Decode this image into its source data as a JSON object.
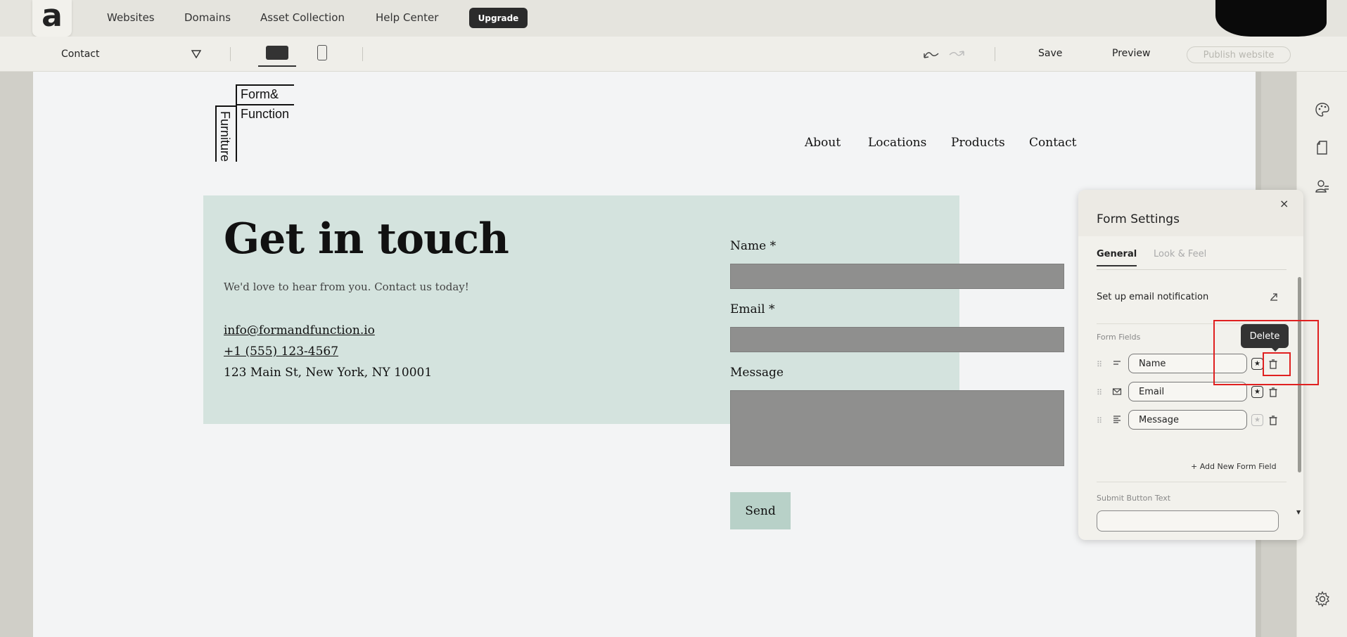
{
  "topnav": {
    "logo_letter": "a",
    "links": [
      "Websites",
      "Domains",
      "Asset Collection",
      "Help Center"
    ],
    "upgrade_label": "Upgrade"
  },
  "toolbar": {
    "page_name": "Contact",
    "save_label": "Save",
    "preview_label": "Preview",
    "publish_label": "Publish website"
  },
  "site": {
    "logo": {
      "line1": "Form&",
      "line2": "Function",
      "vertical": "Furniture"
    },
    "nav": [
      "About",
      "Locations",
      "Products",
      "Contact"
    ],
    "hero_title": "Get in touch",
    "hero_subtitle": "We'd love to hear from you. Contact us today!",
    "email": "info@formandfunction.io",
    "phone": "+1 (555) 123-4567",
    "address": "123 Main St, New York, NY 10001",
    "form": {
      "name_label": "Name *",
      "email_label": "Email *",
      "message_label": "Message",
      "send_label": "Send"
    }
  },
  "panel": {
    "title": "Form Settings",
    "close": "×",
    "tabs": [
      "General",
      "Look & Feel"
    ],
    "email_notification": "Set up email notification",
    "form_fields_label": "Form Fields",
    "tooltip": "Delete",
    "fields": [
      {
        "label": "Name",
        "required": true,
        "icon": "short-text-icon"
      },
      {
        "label": "Email",
        "required": true,
        "icon": "envelope-icon"
      },
      {
        "label": "Message",
        "required": false,
        "icon": "paragraph-icon"
      }
    ],
    "add_field": "+ Add New Form Field",
    "submit_button_label": "Submit Button Text",
    "submit_button_value": ""
  },
  "colors": {
    "accent_dark": "#2b2b2b",
    "band": "#d4e3de",
    "input_fill": "#8f8f8e",
    "send_button": "#b8d1c8",
    "highlight": "#e02020"
  }
}
